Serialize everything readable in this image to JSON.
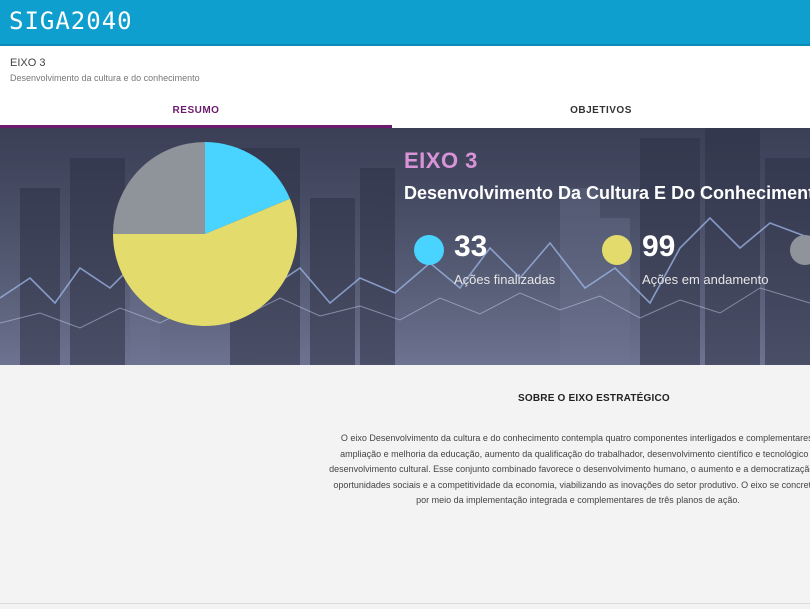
{
  "app": {
    "logo_text": "SIGA2040"
  },
  "page": {
    "code": "EIXO 3",
    "subtitle": "Desenvolvimento da cultura e do conhecimento"
  },
  "tabs": [
    {
      "label": "RESUMO",
      "active": true
    },
    {
      "label": "OBJETIVOS",
      "active": false
    }
  ],
  "hero": {
    "title": "EIXO 3",
    "heading": "Desenvolvimento Da Cultura E Do Conhecimento",
    "stats": [
      {
        "value": "33",
        "label": "Ações finalizadas",
        "color": "#49d3ff"
      },
      {
        "value": "99",
        "label": "Ações em andamento",
        "color": "#e3dc6c"
      },
      {
        "value": "",
        "label": "",
        "color": "#8f939a"
      }
    ]
  },
  "chart_data": {
    "type": "pie",
    "values": [
      33,
      99,
      44
    ],
    "colors": [
      "#49d3ff",
      "#e3dc6c",
      "#8f939a"
    ]
  },
  "about": {
    "title": "SOBRE O EIXO ESTRATÉGICO",
    "lines": [
      "O eixo Desenvolvimento da cultura e do conhecimento contempla quatro componentes interligados e complementares:",
      "ampliação e melhoria da educação, aumento da qualificação do trabalhador, desenvolvimento científico e tecnológico e",
      "desenvolvimento cultural. Esse conjunto combinado favorece o desenvolvimento humano, o aumento e a democratização de",
      "oportunidades sociais e a competitividade da economia, viabilizando as inovações do setor produtivo. O eixo se concretiza",
      "por meio da implementação integrada e complementares de três planos de ação."
    ]
  }
}
